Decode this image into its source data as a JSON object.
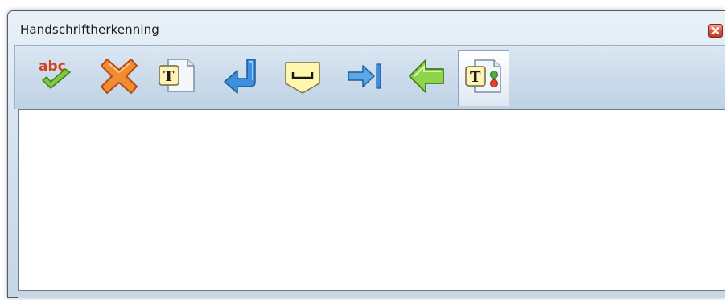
{
  "window": {
    "title": "Handschriftherkenning"
  },
  "titlebar": {
    "close_icon": "close-icon"
  },
  "toolbar": {
    "items": [
      {
        "name": "spellcheck-icon",
        "active": false
      },
      {
        "name": "delete-icon",
        "active": false
      },
      {
        "name": "insert-text-icon",
        "active": false
      },
      {
        "name": "enter-icon",
        "active": false
      },
      {
        "name": "space-icon",
        "active": false
      },
      {
        "name": "tab-icon",
        "active": false
      },
      {
        "name": "backspace-icon",
        "active": false
      },
      {
        "name": "text-options-icon",
        "active": true
      }
    ]
  },
  "colors": {
    "accent_blue": "#3c8fdc",
    "green": "#6dbf3a",
    "orange": "#f08a24",
    "close_red": "#d85a3f"
  }
}
